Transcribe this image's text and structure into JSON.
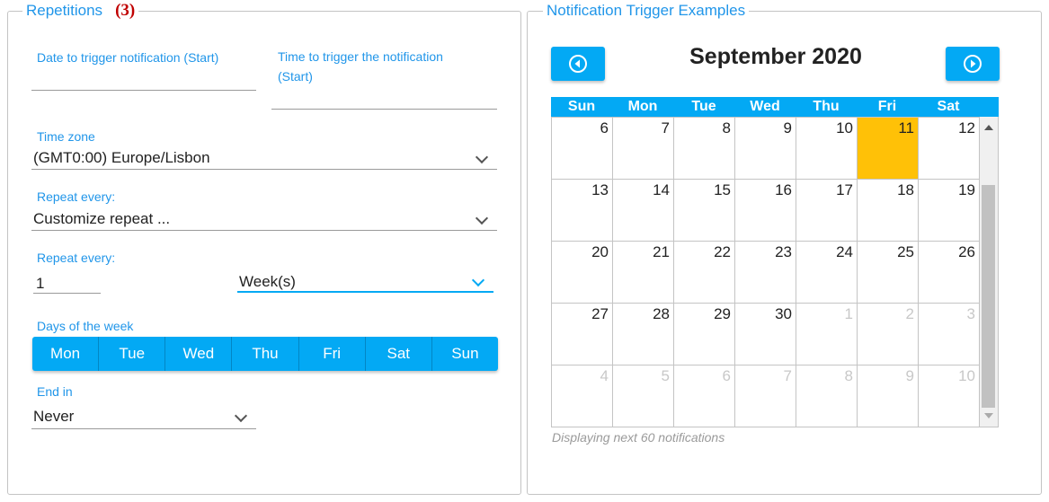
{
  "repetitions": {
    "legend": "Repetitions",
    "badge": "(3)",
    "start_date_label": "Date to trigger notification (Start)",
    "start_time_label_line1": "Time to trigger the notification",
    "start_time_label_line2": "(Start)",
    "timezone_label": "Time zone",
    "timezone_value": "(GMT0:00) Europe/Lisbon",
    "repeat_label": "Repeat every:",
    "repeat_value": "Customize repeat ...",
    "repeat_every_label": "Repeat every:",
    "repeat_count": "1",
    "repeat_unit": "Week(s)",
    "days_label": "Days of the week",
    "days": [
      "Mon",
      "Tue",
      "Wed",
      "Thu",
      "Fri",
      "Sat",
      "Sun"
    ],
    "end_label": "End in",
    "end_value": "Never"
  },
  "examples": {
    "legend": "Notification Trigger Examples",
    "month_title": "September 2020",
    "weekday_headers": [
      "Sun",
      "Mon",
      "Tue",
      "Wed",
      "Thu",
      "Fri",
      "Sat"
    ],
    "weeks": [
      [
        "6",
        "7",
        "8",
        "9",
        "10",
        "11",
        "12"
      ],
      [
        "13",
        "14",
        "15",
        "16",
        "17",
        "18",
        "19"
      ],
      [
        "20",
        "21",
        "22",
        "23",
        "24",
        "25",
        "26"
      ],
      [
        "27",
        "28",
        "29",
        "30",
        "1",
        "2",
        "3"
      ],
      [
        "4",
        "5",
        "6",
        "7",
        "8",
        "9",
        "10"
      ]
    ],
    "highlighted_day": "11",
    "footer": "Displaying next 60 notifications",
    "prev_icon": "circle-arrow-left-icon",
    "next_icon": "circle-arrow-right-icon"
  },
  "colors": {
    "accent": "#03a9f4",
    "label": "#2196e9",
    "highlight": "#ffc107",
    "badge": "#c00000"
  }
}
